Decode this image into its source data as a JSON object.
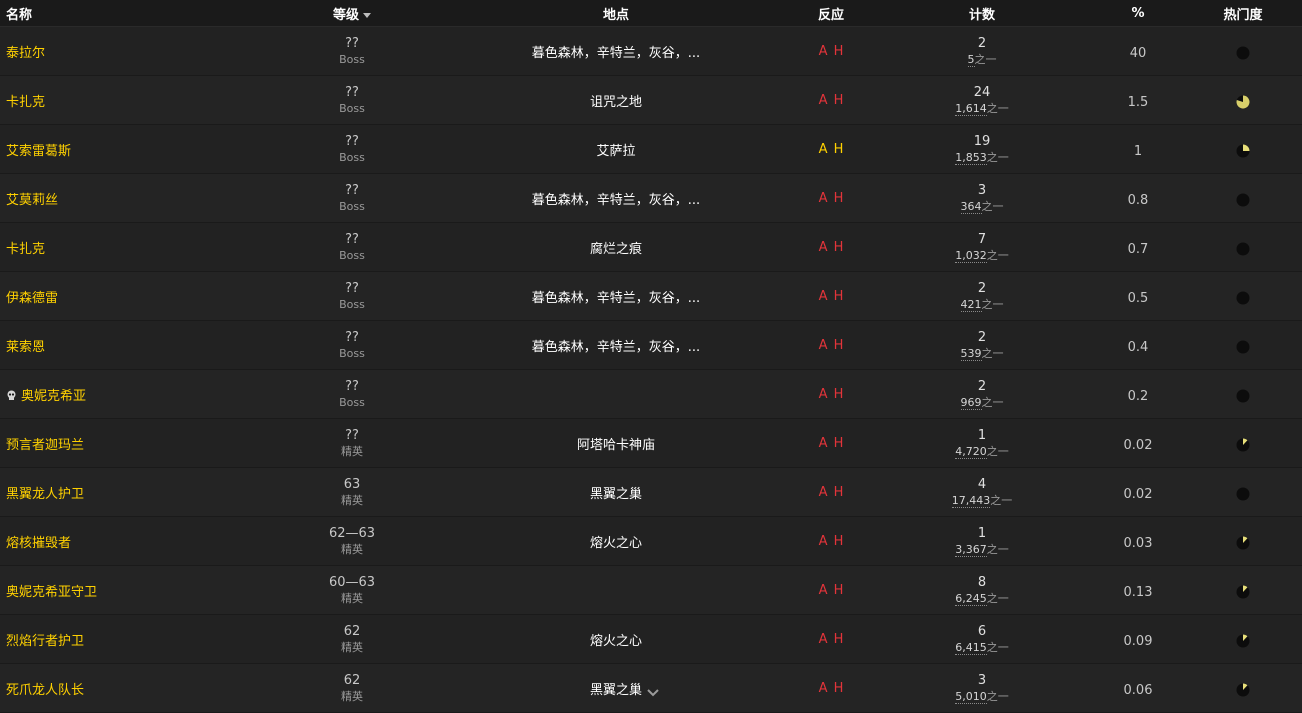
{
  "colors": {
    "name": "#ffd100",
    "reaction_hostile": "#e3343a",
    "reaction_neutral": "#ffd100",
    "background": "#181818",
    "row": "#222222"
  },
  "headers": {
    "name": "名称",
    "level": "等级",
    "location": "地点",
    "reaction": "反应",
    "count": "计数",
    "percent": "%",
    "popularity": "热门度"
  },
  "rows": [
    {
      "name": "泰拉尔",
      "skull": false,
      "level": "??",
      "type": "Boss",
      "location": "暮色森林，辛特兰，灰谷，...",
      "a": "A",
      "h": "H",
      "reaction": "hostile",
      "count": "2",
      "total": "5",
      "suffix": "之一",
      "percent": "40",
      "popularity": 0.0
    },
    {
      "name": "卡扎克",
      "skull": false,
      "level": "??",
      "type": "Boss",
      "location": "诅咒之地",
      "a": "A",
      "h": "H",
      "reaction": "hostile",
      "count": "24",
      "total": "1,614",
      "suffix": "之一",
      "percent": "1.5",
      "popularity": 0.8
    },
    {
      "name": "艾索雷葛斯",
      "skull": false,
      "level": "??",
      "type": "Boss",
      "location": "艾萨拉",
      "a": "A",
      "h": "H",
      "reaction": "neutral",
      "count": "19",
      "total": "1,853",
      "suffix": "之一",
      "percent": "1",
      "popularity": 0.25
    },
    {
      "name": "艾莫莉丝",
      "skull": false,
      "level": "??",
      "type": "Boss",
      "location": "暮色森林，辛特兰，灰谷，...",
      "a": "A",
      "h": "H",
      "reaction": "hostile",
      "count": "3",
      "total": "364",
      "suffix": "之一",
      "percent": "0.8",
      "popularity": 0.0
    },
    {
      "name": "卡扎克",
      "skull": false,
      "level": "??",
      "type": "Boss",
      "location": "腐烂之痕",
      "a": "A",
      "h": "H",
      "reaction": "hostile",
      "count": "7",
      "total": "1,032",
      "suffix": "之一",
      "percent": "0.7",
      "popularity": 0.0
    },
    {
      "name": "伊森德雷",
      "skull": false,
      "level": "??",
      "type": "Boss",
      "location": "暮色森林，辛特兰，灰谷，...",
      "a": "A",
      "h": "H",
      "reaction": "hostile",
      "count": "2",
      "total": "421",
      "suffix": "之一",
      "percent": "0.5",
      "popularity": 0.0
    },
    {
      "name": "莱索恩",
      "skull": false,
      "level": "??",
      "type": "Boss",
      "location": "暮色森林，辛特兰，灰谷，...",
      "a": "A",
      "h": "H",
      "reaction": "hostile",
      "count": "2",
      "total": "539",
      "suffix": "之一",
      "percent": "0.4",
      "popularity": 0.0
    },
    {
      "name": "奥妮克希亚",
      "skull": true,
      "level": "??",
      "type": "Boss",
      "location": "",
      "a": "A",
      "h": "H",
      "reaction": "hostile",
      "count": "2",
      "total": "969",
      "suffix": "之一",
      "percent": "0.2",
      "popularity": 0.0
    },
    {
      "name": "预言者迦玛兰",
      "skull": false,
      "level": "??",
      "type": "精英",
      "location": "阿塔哈卡神庙",
      "a": "A",
      "h": "H",
      "reaction": "hostile",
      "count": "1",
      "total": "4,720",
      "suffix": "之一",
      "percent": "0.02",
      "popularity": 0.12
    },
    {
      "name": "黑翼龙人护卫",
      "skull": false,
      "level": "63",
      "type": "精英",
      "location": "黑翼之巢",
      "a": "A",
      "h": "H",
      "reaction": "hostile",
      "count": "4",
      "total": "17,443",
      "suffix": "之一",
      "percent": "0.02",
      "popularity": 0.0
    },
    {
      "name": "熔核摧毁者",
      "skull": false,
      "level": "62—63",
      "type": "精英",
      "location": "熔火之心",
      "a": "A",
      "h": "H",
      "reaction": "hostile",
      "count": "1",
      "total": "3,367",
      "suffix": "之一",
      "percent": "0.03",
      "popularity": 0.12
    },
    {
      "name": "奥妮克希亚守卫",
      "skull": false,
      "level": "60—63",
      "type": "精英",
      "location": "",
      "a": "A",
      "h": "H",
      "reaction": "hostile",
      "count": "8",
      "total": "6,245",
      "suffix": "之一",
      "percent": "0.13",
      "popularity": 0.12
    },
    {
      "name": "烈焰行者护卫",
      "skull": false,
      "level": "62",
      "type": "精英",
      "location": "熔火之心",
      "a": "A",
      "h": "H",
      "reaction": "hostile",
      "count": "6",
      "total": "6,415",
      "suffix": "之一",
      "percent": "0.09",
      "popularity": 0.12
    },
    {
      "name": "死爪龙人队长",
      "skull": false,
      "level": "62",
      "type": "精英",
      "location": "黑翼之巢",
      "a": "A",
      "h": "H",
      "reaction": "hostile",
      "count": "3",
      "total": "5,010",
      "suffix": "之一",
      "percent": "0.06",
      "popularity": 0.12
    }
  ]
}
